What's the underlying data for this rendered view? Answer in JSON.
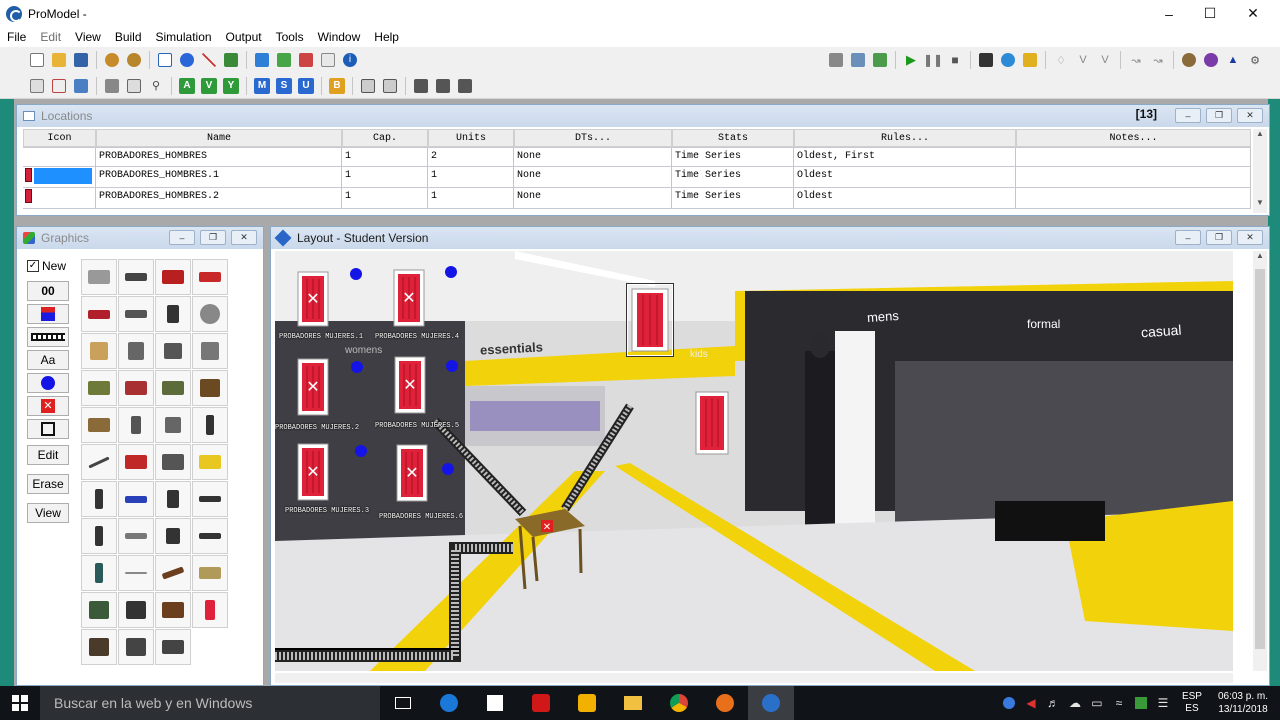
{
  "window": {
    "title": "ProModel -"
  },
  "menu": [
    "File",
    "Edit",
    "View",
    "Build",
    "Simulation",
    "Output",
    "Tools",
    "Window",
    "Help"
  ],
  "locations": {
    "title": "Locations",
    "counter": "[13]",
    "columns": [
      "Icon",
      "Name",
      "Cap.",
      "Units",
      "DTs...",
      "Stats",
      "Rules...",
      "Notes..."
    ],
    "rows": [
      {
        "name": "PROBADORES_HOMBRES",
        "cap": "1",
        "units": "2",
        "dts": "None",
        "stats": "Time Series",
        "rules": "Oldest, First",
        "notes": ""
      },
      {
        "name": "PROBADORES_HOMBRES.1",
        "cap": "1",
        "units": "1",
        "dts": "None",
        "stats": "Time Series",
        "rules": "Oldest",
        "notes": ""
      },
      {
        "name": "PROBADORES_HOMBRES.2",
        "cap": "1",
        "units": "1",
        "dts": "None",
        "stats": "Time Series",
        "rules": "Oldest",
        "notes": ""
      }
    ]
  },
  "graphics": {
    "title": "Graphics",
    "new_label": "New",
    "buttons": [
      "00",
      "Aa",
      "Edit",
      "Erase",
      "View"
    ]
  },
  "layout": {
    "title": "Layout - Student Version",
    "scene_text": {
      "mens": "mens",
      "formal": "formal",
      "casual": "casual",
      "essentials": "essentials",
      "kids": "kids",
      "womens": "womens"
    },
    "labels": [
      "PROBADORES MUJERES.1",
      "PROBADORES MUJERES.4",
      "PROBADORES MUJERES.2",
      "PROBADORES MUJERES.5",
      "PROBADORES MUJERES.3",
      "PROBADORES MUJERES.6"
    ]
  },
  "taskbar": {
    "search_placeholder": "Buscar en la web y en Windows",
    "lang_top": "ESP",
    "lang_bottom": "ES",
    "time": "06:03 p. m.",
    "date": "13/11/2018"
  },
  "colors": {
    "accent": "#1e90ff",
    "fitting_room": "#e0213a",
    "blue_node": "#1414e6",
    "mdi_teal": "#1d8a7a"
  }
}
